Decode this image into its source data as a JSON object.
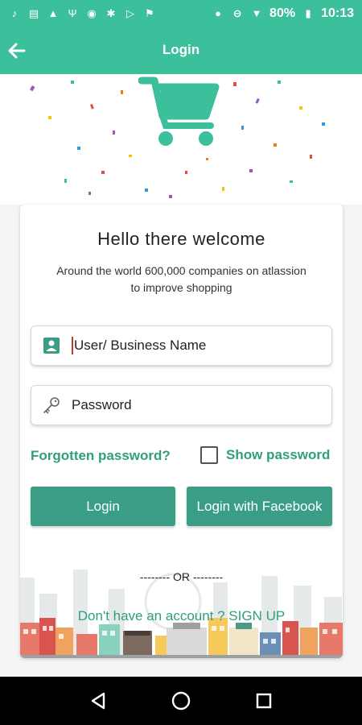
{
  "status_bar": {
    "battery": "80%",
    "time": "10:13",
    "icons": [
      "tiktok-icon",
      "message-icon",
      "warning-icon",
      "usb-icon",
      "app-icon",
      "club-icon",
      "play-store-icon",
      "flag-icon",
      "location-icon",
      "do-not-disturb-icon",
      "wifi-icon",
      "battery-icon"
    ]
  },
  "app_bar": {
    "title": "Login",
    "back_icon": "arrow-left-icon"
  },
  "hero": {
    "icon": "shopping-cart-icon",
    "accent_color": "#3cbf9b"
  },
  "card": {
    "heading": "Hello there welcome",
    "subtitle_line1": "Around the world 600,000 companies  on atlassion",
    "subtitle_line2": "to improve shopping",
    "username_placeholder": "User/ Business Name",
    "username_value": "",
    "password_placeholder": "Password",
    "password_value": "",
    "forgot_label": "Forgotten password?",
    "show_password_label": "Show password",
    "show_password_checked": false,
    "login_button": "Login",
    "facebook_button": "Login with Facebook",
    "or_divider": "-------- OR --------",
    "signup_text": "Don't have an account ? SIGN UP"
  },
  "nav_bar": {
    "back": "back-triangle-icon",
    "home": "home-circle-icon",
    "recents": "recents-square-icon"
  },
  "colors": {
    "primary": "#3cbf9b",
    "button": "#3a9e86",
    "link": "#2f9e7f"
  }
}
